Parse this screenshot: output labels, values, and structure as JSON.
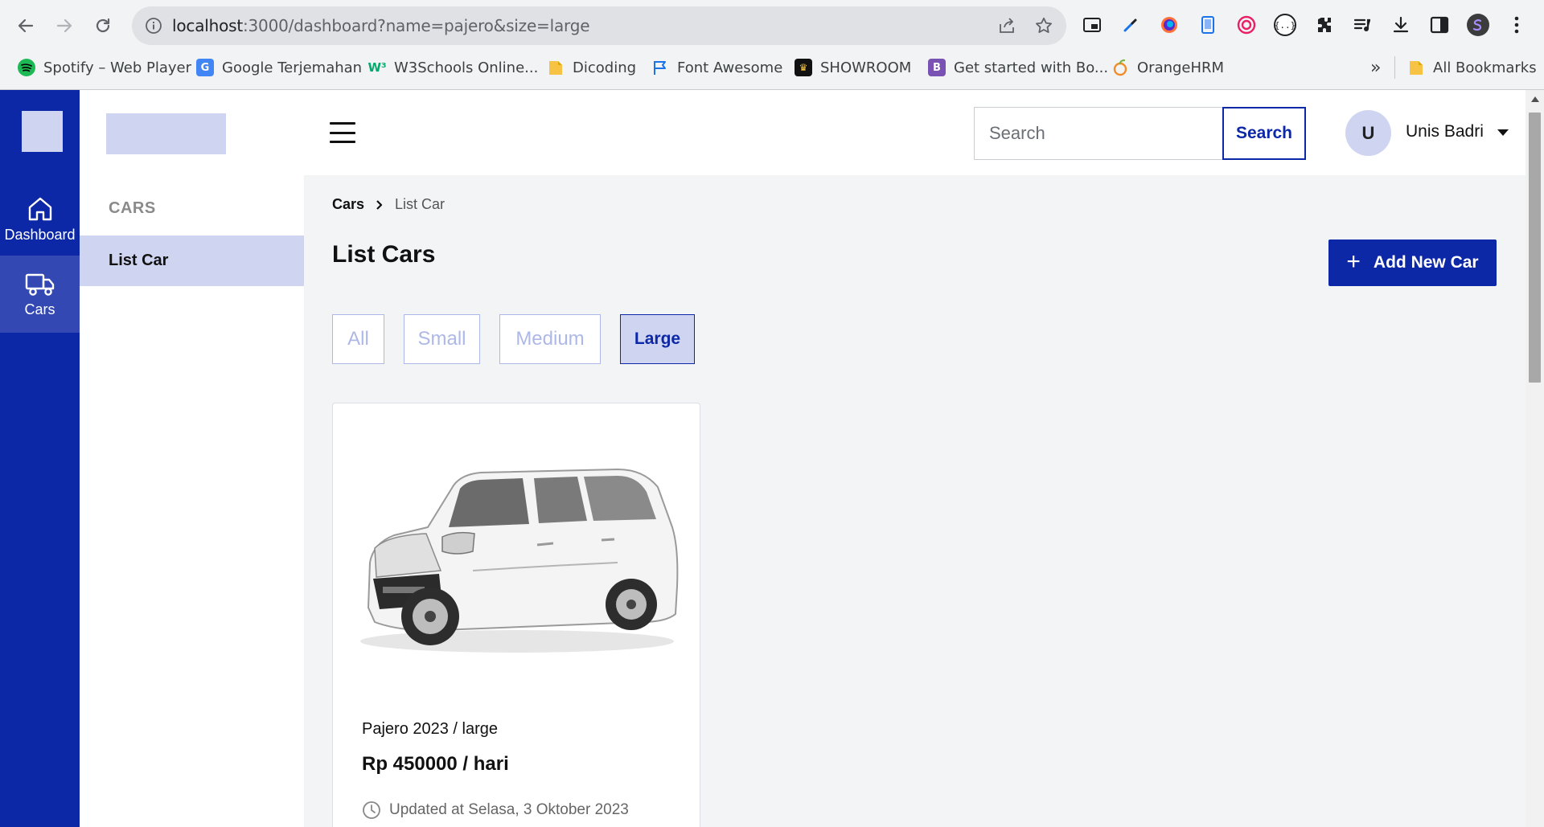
{
  "browser": {
    "url_host": "localhost",
    "url_rest": ":3000/dashboard?name=pajero&size=large",
    "bookmarks": [
      {
        "label": "Spotify – Web Player",
        "icon": "spotify-icon",
        "color": "#1db954"
      },
      {
        "label": "Google Terjemahan",
        "icon": "google-translate-icon",
        "color": "#4285f4"
      },
      {
        "label": "W3Schools Online...",
        "icon": "w3schools-icon",
        "color": "#04aa6d"
      },
      {
        "label": "Dicoding",
        "icon": "folder-icon",
        "color": "#f6c344"
      },
      {
        "label": "Font Awesome",
        "icon": "flag-icon",
        "color": "#1a73e8"
      },
      {
        "label": "SHOWROOM",
        "icon": "showroom-icon",
        "color": "#111111"
      },
      {
        "label": "Get started with Bo...",
        "icon": "bootstrap-icon",
        "color": "#7952b3"
      },
      {
        "label": "OrangeHRM",
        "icon": "orangehrm-icon",
        "color": "#f28c28"
      }
    ],
    "overflow_label": "»",
    "all_bookmarks_label": "All Bookmarks"
  },
  "sidebar": {
    "rail": [
      {
        "label": "Dashboard",
        "icon": "home-icon",
        "active": false
      },
      {
        "label": "Cars",
        "icon": "truck-icon",
        "active": true
      }
    ],
    "section_title": "CARS",
    "items": [
      {
        "label": "List Car",
        "active": true
      }
    ]
  },
  "topbar": {
    "search_placeholder": "Search",
    "search_button": "Search",
    "user_initial": "U",
    "user_name": "Unis Badri"
  },
  "main": {
    "breadcrumb": [
      "Cars",
      "List Car"
    ],
    "title": "List Cars",
    "add_button": "Add New Car",
    "filters": [
      {
        "label": "All",
        "active": false
      },
      {
        "label": "Small",
        "active": false
      },
      {
        "label": "Medium",
        "active": false
      },
      {
        "label": "Large",
        "active": true
      }
    ],
    "cars": [
      {
        "name": "Pajero 2023 / large",
        "price": "Rp 450000 / hari",
        "updated": "Updated at Selasa, 3 Oktober 2023"
      }
    ]
  },
  "colors": {
    "primary": "#0d28a6",
    "primary_light": "#cfd4f1",
    "filter_inactive": "#aeb8e8",
    "background": "#f3f4f6"
  }
}
